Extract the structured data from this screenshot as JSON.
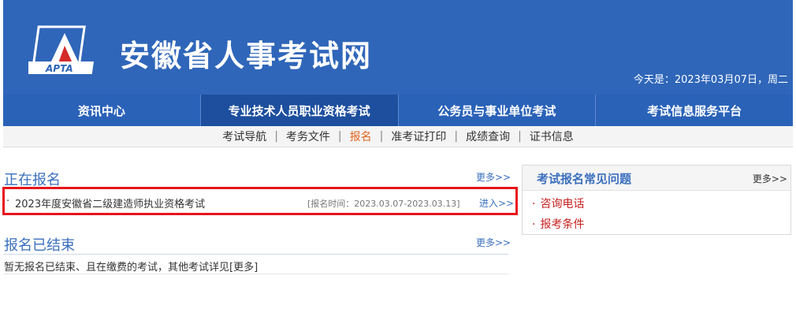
{
  "header": {
    "logo_text": "APTA",
    "title": "安徽省人事考试网",
    "date": "今天是：2023年03月07日，周二"
  },
  "mainnav": [
    {
      "label": "资讯中心"
    },
    {
      "label": "专业技术人员职业资格考试"
    },
    {
      "label": "公务员与事业单位考试"
    },
    {
      "label": "考试信息服务平台"
    }
  ],
  "subnav": [
    {
      "label": "考试导航"
    },
    {
      "label": "考务文件"
    },
    {
      "label": "报名"
    },
    {
      "label": "准考证打印"
    },
    {
      "label": "成绩查询"
    },
    {
      "label": "证书信息"
    }
  ],
  "registering": {
    "title": "正在报名",
    "more": "更多>>",
    "item": {
      "bullet": "·",
      "name": "2023年度安徽省二级建造师执业资格考试",
      "date": "[报名时间：2023.03.07-2023.03.13]",
      "enter": "进入>>"
    }
  },
  "ended": {
    "title": "报名已结束",
    "more": "更多>>",
    "text": "暂无报名已结束、且在缴费的考试，其他考试详见[更多]"
  },
  "faq": {
    "title": "考试报名常见问题",
    "more": "更多>>",
    "items": [
      {
        "label": "咨询电话"
      },
      {
        "label": "报考条件"
      }
    ]
  },
  "colors": {
    "header_bg": "#2f66b9",
    "highlight": "#e8141b",
    "link": "#3b6fbd",
    "active_sub": "#e0641e"
  }
}
